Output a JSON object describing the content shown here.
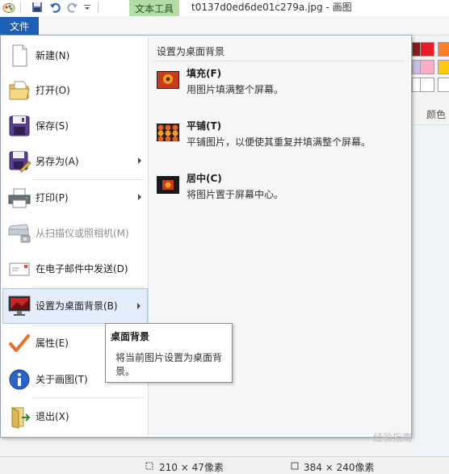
{
  "title_bar": {
    "contextual_tab": "文本工具",
    "window_title": "t0137d0ed6de01c279a.jpg - 画图"
  },
  "file_tab": {
    "label": "文件"
  },
  "menu": {
    "items": [
      {
        "label": "新建(N)",
        "icon": "new-file-icon"
      },
      {
        "label": "打开(O)",
        "icon": "open-folder-icon"
      },
      {
        "label": "保存(S)",
        "icon": "save-disk-icon"
      },
      {
        "label": "另存为(A)",
        "icon": "save-as-icon",
        "submenu": true
      },
      {
        "label": "打印(P)",
        "icon": "printer-icon",
        "submenu": true
      },
      {
        "label": "从扫描仪或照相机(M)",
        "icon": "scanner-camera-icon",
        "disabled": true
      },
      {
        "label": "在电子邮件中发送(D)",
        "icon": "email-icon"
      },
      {
        "label": "设置为桌面背景(B)",
        "icon": "desktop-background-icon",
        "submenu": true,
        "active": true
      },
      {
        "label": "属性(E)",
        "icon": "checkmark-icon"
      },
      {
        "label": "关于画图(T)",
        "icon": "info-icon"
      },
      {
        "label": "退出(X)",
        "icon": "exit-icon"
      }
    ]
  },
  "submenu": {
    "title": "设置为桌面背景",
    "options": [
      {
        "title": "填充(F)",
        "desc": "用图片填满整个屏幕。",
        "icon": "fill-thumbnail-icon"
      },
      {
        "title": "平铺(T)",
        "desc": "平铺图片，以便使其重复并填满整个屏幕。",
        "icon": "tile-thumbnail-icon"
      },
      {
        "title": "居中(C)",
        "desc": "将图片置于屏幕中心。",
        "icon": "center-thumbnail-icon"
      }
    ]
  },
  "tooltip": {
    "title": "桌面背景",
    "body": "将当前图片设置为桌面背景。"
  },
  "ribbon": {
    "colors_label": "颜色"
  },
  "status_bar": {
    "selection_size": "210 × 47像素",
    "image_size": "384 × 240像素"
  },
  "watermark": "经验指南",
  "colors": {
    "file_tab": "#1e5eb5",
    "contextual_tab": "#b4dca5",
    "active_item": "#e4eefa",
    "palette": [
      "#8b1a1a",
      "#e81c24",
      "#ff7f27",
      "#c8bfe7",
      "#ffaec9",
      "#ffc90e"
    ]
  }
}
